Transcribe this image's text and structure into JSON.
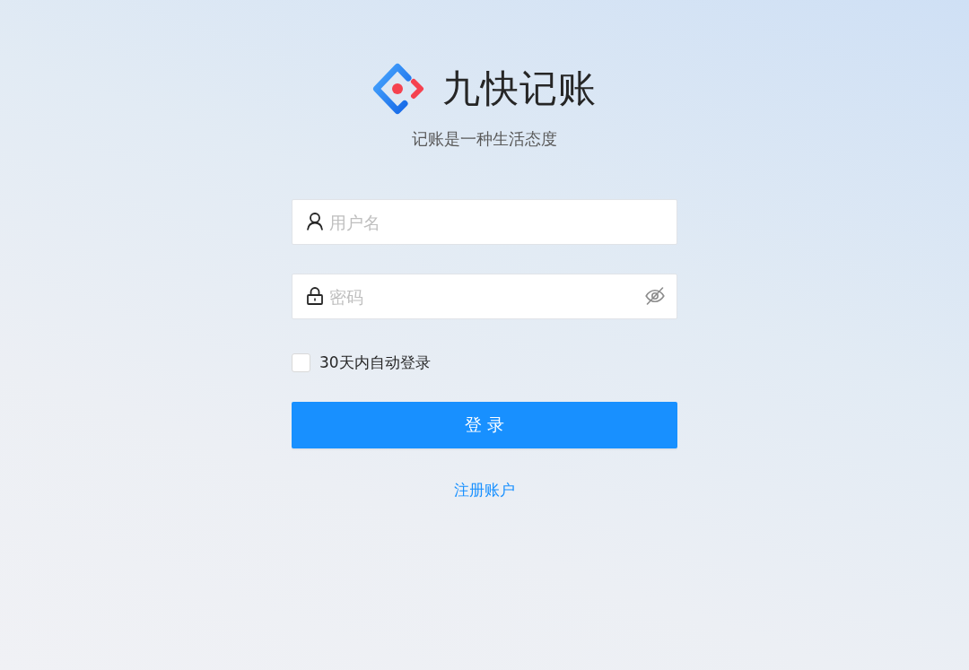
{
  "header": {
    "title": "九快记账",
    "slogan": "记账是一种生活态度"
  },
  "form": {
    "fields": [
      {
        "kind": "username",
        "placeholder": "用户名"
      },
      {
        "kind": "password",
        "placeholder": "密码",
        "password_visible": false
      }
    ],
    "remember": {
      "label": "30天内自动登录",
      "checked": false
    },
    "submit": {
      "label": "登 录"
    },
    "register_link": {
      "label": "注册账户"
    }
  }
}
